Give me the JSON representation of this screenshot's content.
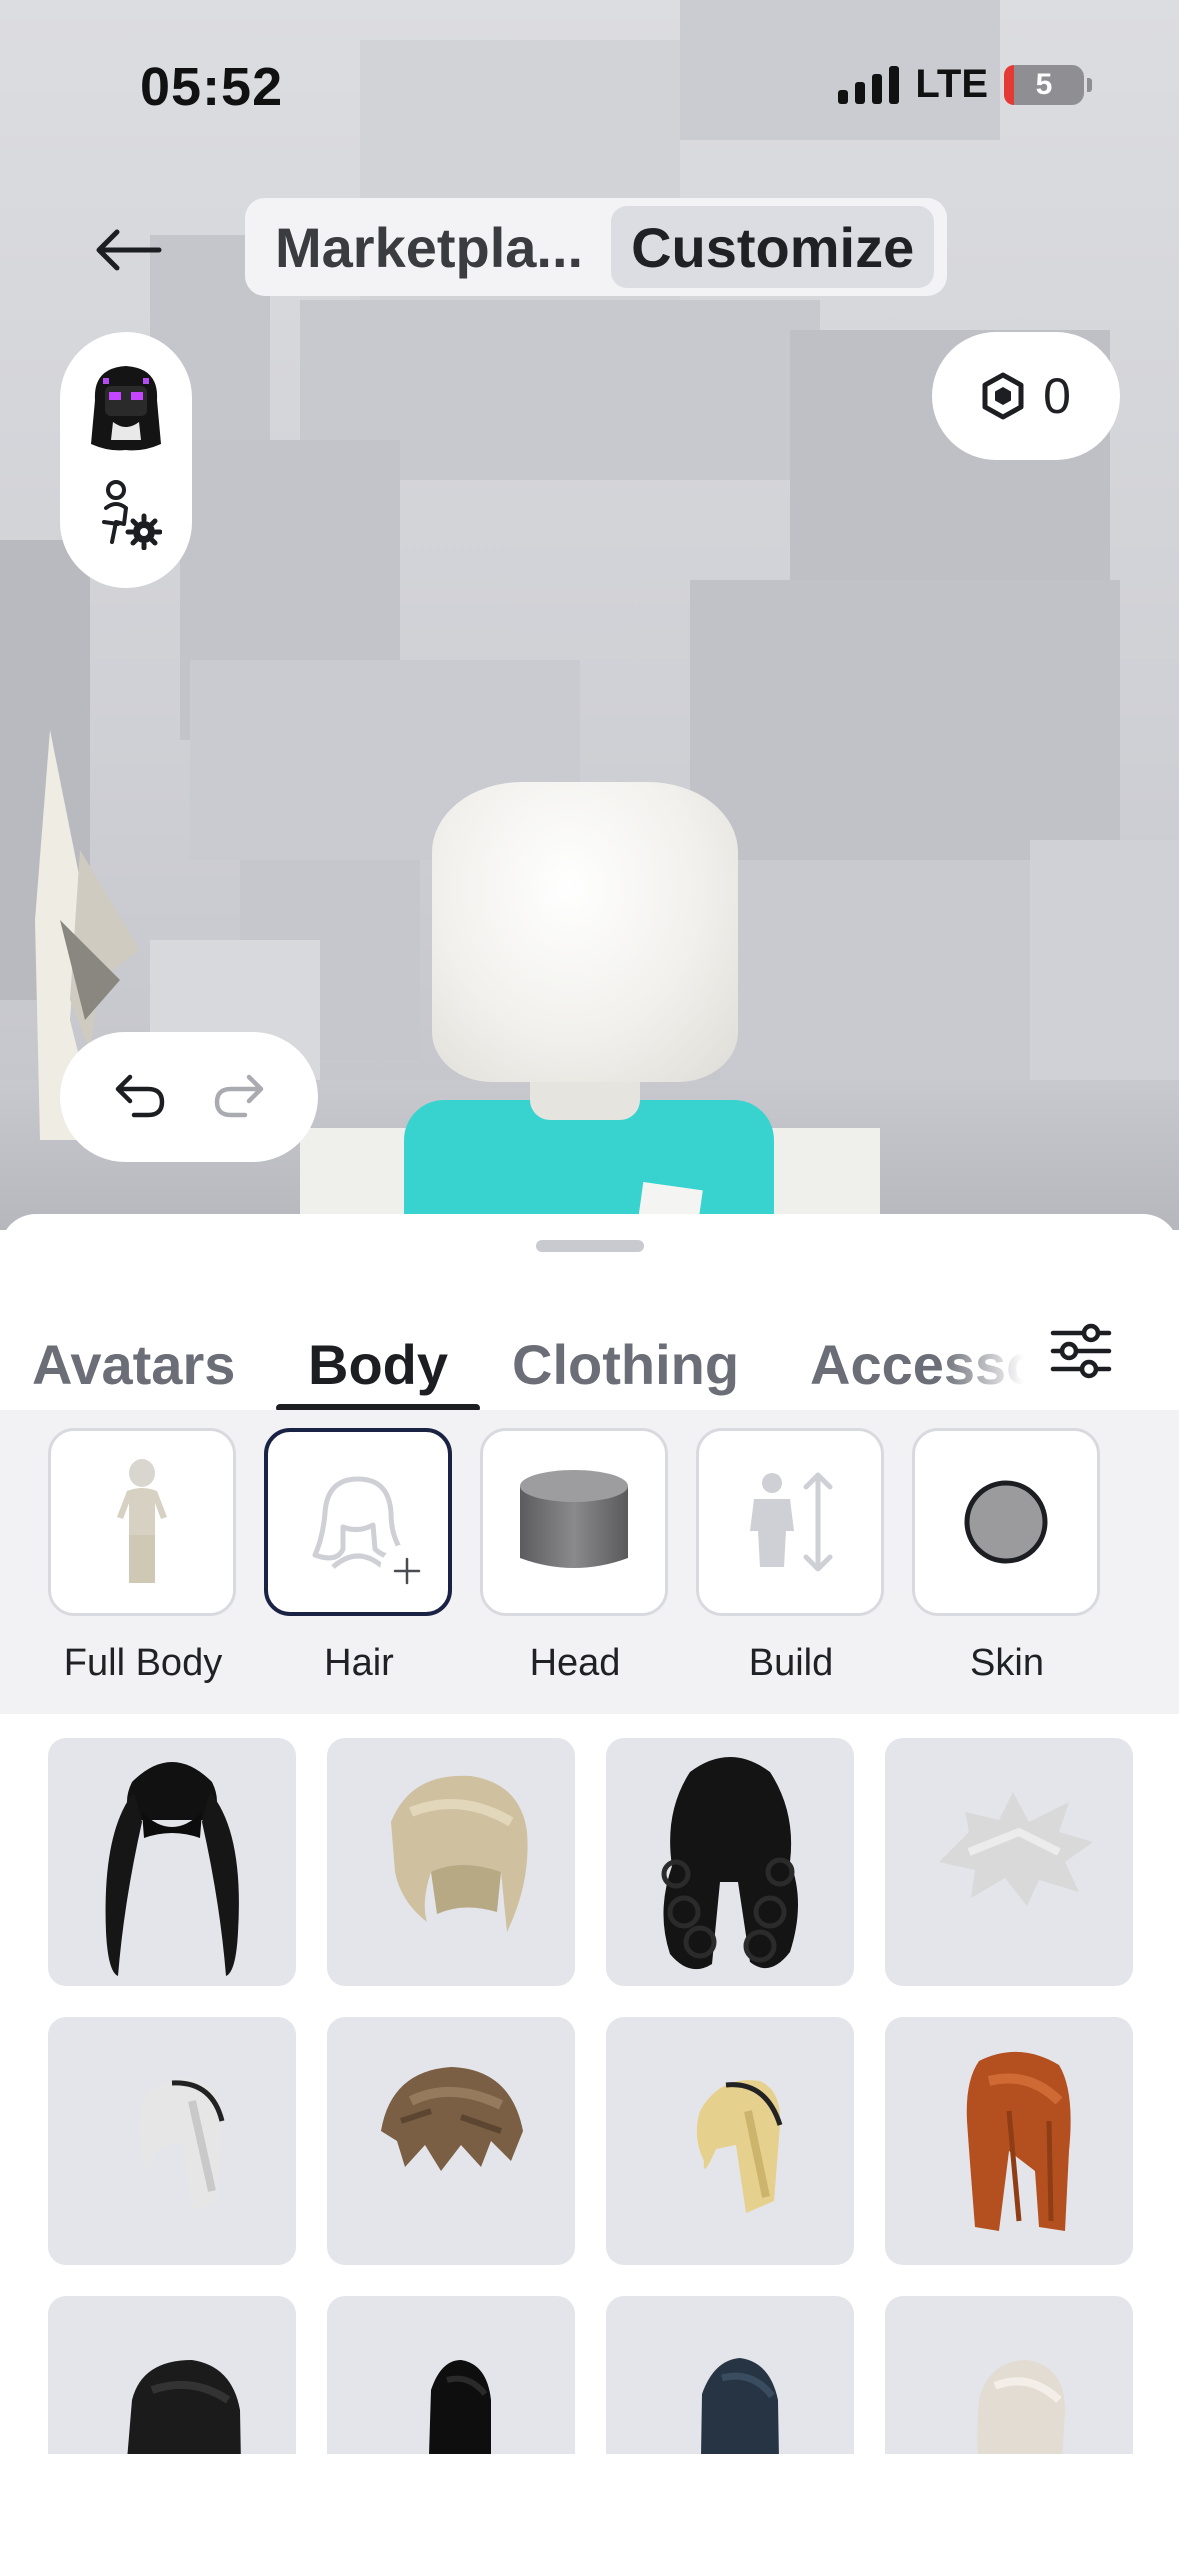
{
  "status_bar": {
    "time": "05:52",
    "network": "LTE",
    "battery": "5"
  },
  "header": {
    "segments": [
      {
        "label": "Marketpla...",
        "active": false
      },
      {
        "label": "Customize",
        "active": true
      }
    ]
  },
  "robux": {
    "balance": "0"
  },
  "tabs": [
    {
      "label": "Avatars",
      "active": false
    },
    {
      "label": "Body",
      "active": true
    },
    {
      "label": "Clothing",
      "active": false
    },
    {
      "label": "Accesso",
      "active": false
    }
  ],
  "body_categories": [
    {
      "label": "Full Body",
      "icon": "full-body-icon",
      "selected": false
    },
    {
      "label": "Hair",
      "icon": "hair-add-icon",
      "selected": true
    },
    {
      "label": "Head",
      "icon": "head-icon",
      "selected": false
    },
    {
      "label": "Build",
      "icon": "build-icon",
      "selected": false
    },
    {
      "label": "Skin",
      "icon": "skin-icon",
      "selected": false
    }
  ],
  "hair_items": [
    {
      "name": "black-pigtails-hair",
      "color": "#111111"
    },
    {
      "name": "blonde-bob-hair",
      "color": "#cbbd9c"
    },
    {
      "name": "black-curly-hair",
      "color": "#141414"
    },
    {
      "name": "white-spiky-hair",
      "color": "#d9d9d9"
    },
    {
      "name": "white-straight-hair",
      "color": "#e9e9e9"
    },
    {
      "name": "brown-messy-hair",
      "color": "#7a5f45"
    },
    {
      "name": "blonde-straight-hair",
      "color": "#e6d08d"
    },
    {
      "name": "ginger-layered-hair",
      "color": "#b4501f"
    },
    {
      "name": "black-wavy-hair",
      "color": "#1b1b1b"
    },
    {
      "name": "black-long-hair",
      "color": "#0e0e0e"
    },
    {
      "name": "dark-blue-long-hair",
      "color": "#263444"
    },
    {
      "name": "platinum-long-hair",
      "color": "#e2dcd3"
    }
  ]
}
